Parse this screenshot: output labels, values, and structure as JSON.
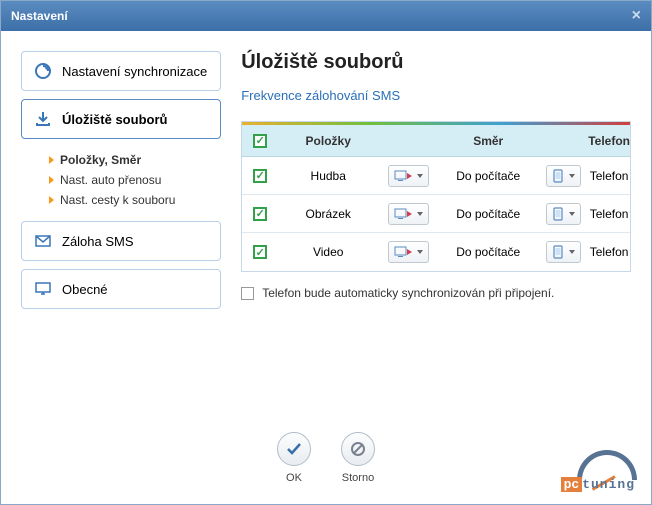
{
  "window": {
    "title": "Nastavení"
  },
  "sidebar": {
    "sync": "Nastavení synchronizace",
    "storage": "Úložiště souborů",
    "sub": {
      "items_dir": "Položky, Směr",
      "auto_transfer": "Nast. auto přenosu",
      "file_path": "Nast. cesty k souboru"
    },
    "sms": "Záloha SMS",
    "general": "Obecné"
  },
  "content": {
    "heading": "Úložiště souborů",
    "link": "Frekvence zálohování SMS",
    "headers": {
      "items": "Položky",
      "direction": "Směr",
      "phone": "Telefon"
    },
    "rows": [
      {
        "item": "Hudba",
        "dir": "Do počítače",
        "phone": "Telefon"
      },
      {
        "item": "Obrázek",
        "dir": "Do počítače",
        "phone": "Telefon"
      },
      {
        "item": "Video",
        "dir": "Do počítače",
        "phone": "Telefon"
      }
    ],
    "auto_sync": "Telefon bude automaticky synchronizován při připojení."
  },
  "footer": {
    "ok": "OK",
    "cancel": "Storno"
  },
  "icons": {
    "check": "✓"
  }
}
